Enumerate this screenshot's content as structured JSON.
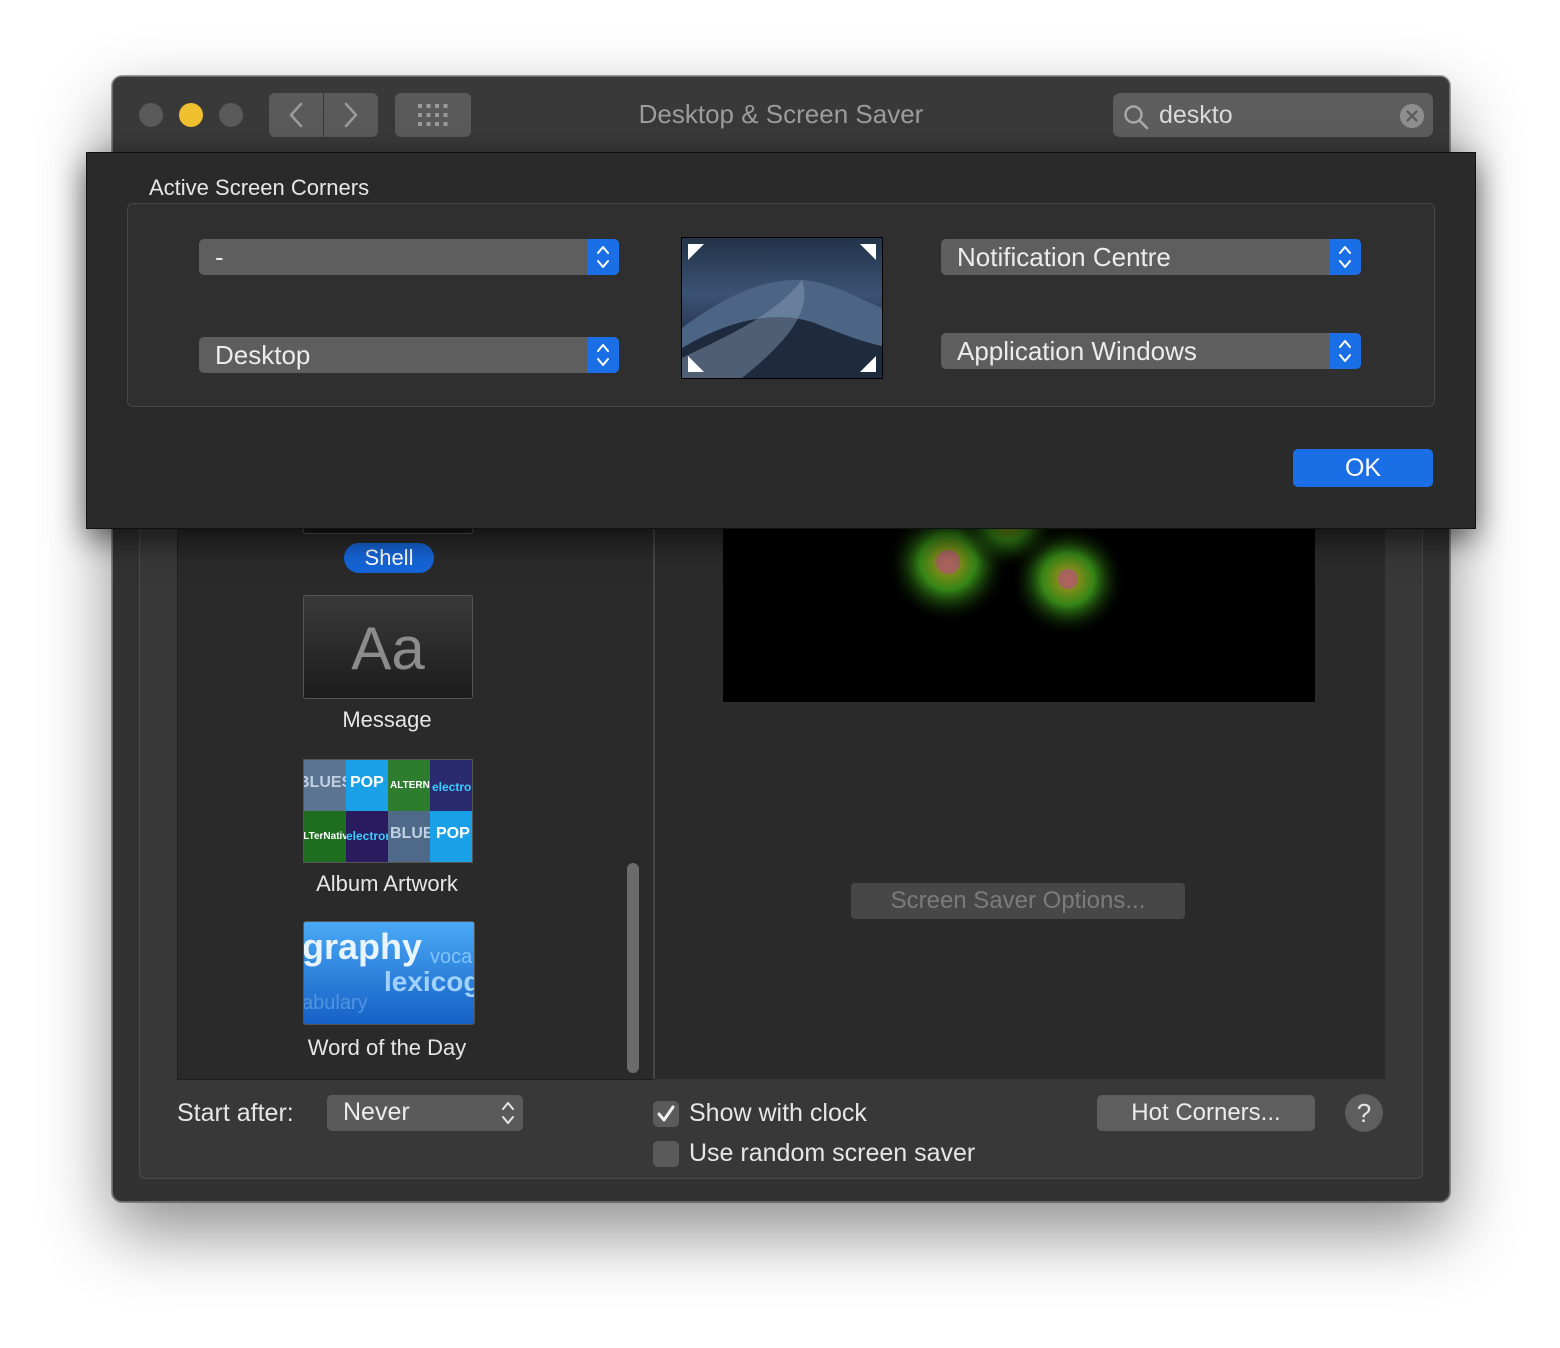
{
  "window": {
    "title": "Desktop & Screen Saver"
  },
  "search": {
    "value": "deskto"
  },
  "sheet": {
    "title": "Active Screen Corners",
    "corners": {
      "top_left": "-",
      "bottom_left": "Desktop",
      "top_right": "Notification Centre",
      "bottom_right": "Application Windows"
    },
    "ok_label": "OK"
  },
  "screen_savers": {
    "items": [
      {
        "label": "Shell",
        "selected": true
      },
      {
        "label": "Message",
        "thumbnail_text": "Aa"
      },
      {
        "label": "Album Artwork",
        "thumbnail_text": [
          "BLUES",
          "POP",
          "ALTERNATIVE",
          "electronic",
          "ALTerNative",
          "electronic",
          "BLUES",
          "POP"
        ]
      },
      {
        "label": "Word of the Day",
        "thumbnail_text": [
          "graphy",
          "voca",
          "lexicog",
          "abulary"
        ]
      }
    ]
  },
  "options_button": "Screen Saver Options...",
  "bottom": {
    "start_after_label": "Start after:",
    "start_after_value": "Never",
    "show_clock_label": "Show with clock",
    "show_clock_checked": true,
    "random_label": "Use random screen saver",
    "random_checked": false,
    "hot_corners_label": "Hot Corners...",
    "help_label": "?"
  },
  "colors": {
    "accent": "#1a6fe6",
    "window_bg": "#323232",
    "sheet_bg": "#2a2a2a",
    "traffic_minimize": "#f0c02e"
  }
}
